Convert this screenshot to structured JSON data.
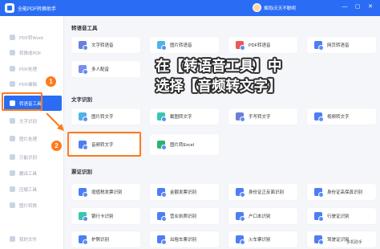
{
  "window": {
    "title": "全能PDF转换助手",
    "username": "烟雨i天天不聪明",
    "minimize": "—",
    "maximize": "▢",
    "close": "✕"
  },
  "sidebar": {
    "items": [
      {
        "label": "PDF转Word"
      },
      {
        "label": "转换成PDF"
      },
      {
        "label": "PDF处理"
      },
      {
        "label": "PDF编辑"
      },
      {
        "label": "转语音工具",
        "active": true
      },
      {
        "label": "文字识别"
      },
      {
        "label": "图片处理"
      },
      {
        "label": "万能识别"
      },
      {
        "label": "翻译工具"
      },
      {
        "label": "压缩工具"
      },
      {
        "label": "图片转换"
      },
      {
        "label": "我的文件"
      }
    ]
  },
  "sections": {
    "voice": {
      "title": "转语音工具",
      "cards": [
        "文字转语音",
        "图片转语音",
        "PDF转语音",
        "网页转语音",
        "多人配音"
      ]
    },
    "ocr": {
      "title": "文字识别",
      "cards": [
        "图片转文字",
        "截图转文字",
        "手写转文字",
        "视频转文字",
        "音频转文字",
        "图片转Excel"
      ]
    },
    "ticket": {
      "title": "票证识别",
      "cards": [
        "增值税发票识别",
        "金额发票识别",
        "身份证正反面识别",
        "身份证高保真识别",
        "银行卡识别",
        "营业执照识别",
        "户口本识别",
        "行驶证识别",
        "护照识别",
        "出租车票识别",
        "火车票识别",
        "驾驶证识别"
      ]
    }
  },
  "callouts": {
    "step1": "1",
    "step2": "2",
    "line1": "在【转语音工具】中",
    "line2": "选择【音频转文字】"
  },
  "watermark": "多机助手",
  "colors": {
    "accent": "#2a6df4",
    "highlight": "#ff7a1a"
  },
  "icons": [
    "app-logo-icon",
    "avatar",
    "sidebar-item-icon",
    "text-icon",
    "image-icon",
    "pdf-icon",
    "web-icon",
    "people-icon",
    "audio-icon",
    "excel-icon",
    "invoice-icon",
    "id-card-icon",
    "bank-card-icon",
    "license-icon",
    "passport-icon",
    "ticket-icon"
  ]
}
